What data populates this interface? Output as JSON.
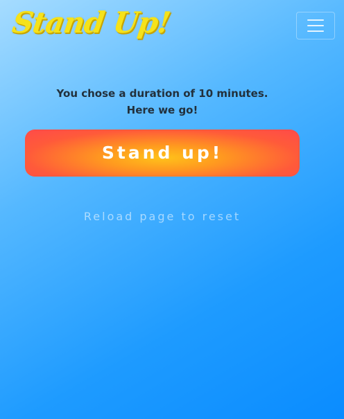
{
  "navbar": {
    "brand": "Stand Up!",
    "menu_icon": "hamburger-menu-icon"
  },
  "main": {
    "message_line1": "You chose a duration of 10 minutes.",
    "message_line2": "Here we go!",
    "stand_button_label": "Stand up!",
    "reload_text": "Reload page to reset"
  },
  "colors": {
    "brand": "#f5e21a",
    "button_start": "#ffc21a",
    "button_end": "#ff4a4a",
    "background_top": "#a6dcff",
    "background_bottom": "#0a8cff",
    "message_text": "#22303c"
  }
}
